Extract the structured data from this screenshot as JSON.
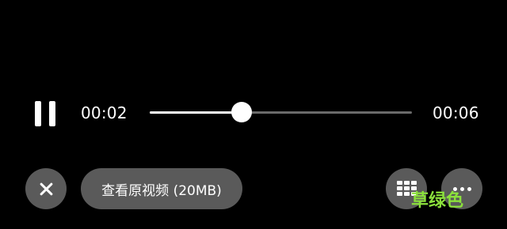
{
  "player": {
    "current_time": "00:02",
    "total_time": "00:06",
    "progress_fraction": 0.35,
    "state": "playing"
  },
  "controls": {
    "pause_icon": "pause-icon",
    "close_icon": "close-icon",
    "grid_icon": "grid-icon",
    "more_icon": "more-horizontal-icon",
    "view_original_label": "查看原视频 (20MB)"
  },
  "watermark": {
    "text": "草绿色"
  },
  "colors": {
    "background": "#000000",
    "button_background": "#5a5a5a",
    "track_unplayed": "#6a6a6a",
    "track_played": "#ffffff",
    "watermark": "#8be03c"
  }
}
